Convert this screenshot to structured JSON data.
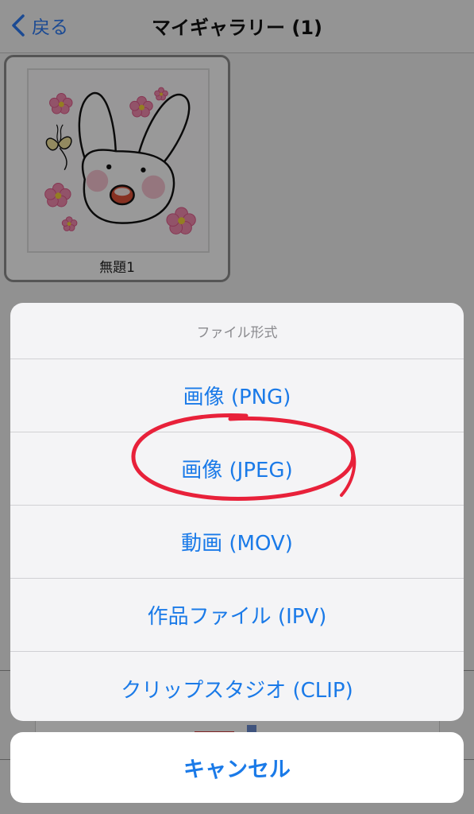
{
  "navbar": {
    "back_label": "戻る",
    "title": "マイギャラリー (1)"
  },
  "gallery": {
    "items": [
      {
        "title": "無題1"
      }
    ]
  },
  "action_sheet": {
    "header": "ファイル形式",
    "options": [
      {
        "label": "画像 (PNG)"
      },
      {
        "label": "画像 (JPEG)"
      },
      {
        "label": "動画 (MOV)"
      },
      {
        "label": "作品ファイル (IPV)"
      },
      {
        "label": "クリップスタジオ (CLIP)"
      }
    ],
    "cancel_label": "キャンセル"
  },
  "colors": {
    "accent": "#1a7ae8",
    "annotation": "#e8213a"
  }
}
